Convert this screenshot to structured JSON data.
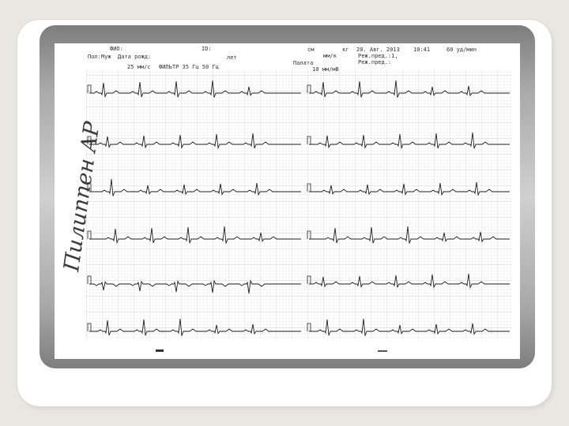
{
  "slide": {
    "handwritten_signature": "Пилиппен АР"
  },
  "ecg": {
    "header": {
      "fio": "ФИО:",
      "id": "ID:",
      "sex": "Пол:Муж",
      "birth_date": "Дата рожд:",
      "age_unit": "лет",
      "sm": "см",
      "kg": "кг",
      "weight_unit": "мм/к",
      "ward": "Палата",
      "date": "20. Авг. 2013",
      "time": "10:41",
      "heart_rate": "60 уд/мин",
      "mode": "Реж.пред.:1,",
      "mode2": "Реж.пред.:",
      "speed_left": "25 мм/с",
      "filter": "ФИЛЬТР 35 Гц 50 Гц",
      "speed_right": "10 мм/мВ"
    },
    "rows": 6,
    "colors": {
      "trace": "#1e1e1e",
      "grid": "#c8c8c8",
      "panel": "#a8a8a8"
    }
  }
}
